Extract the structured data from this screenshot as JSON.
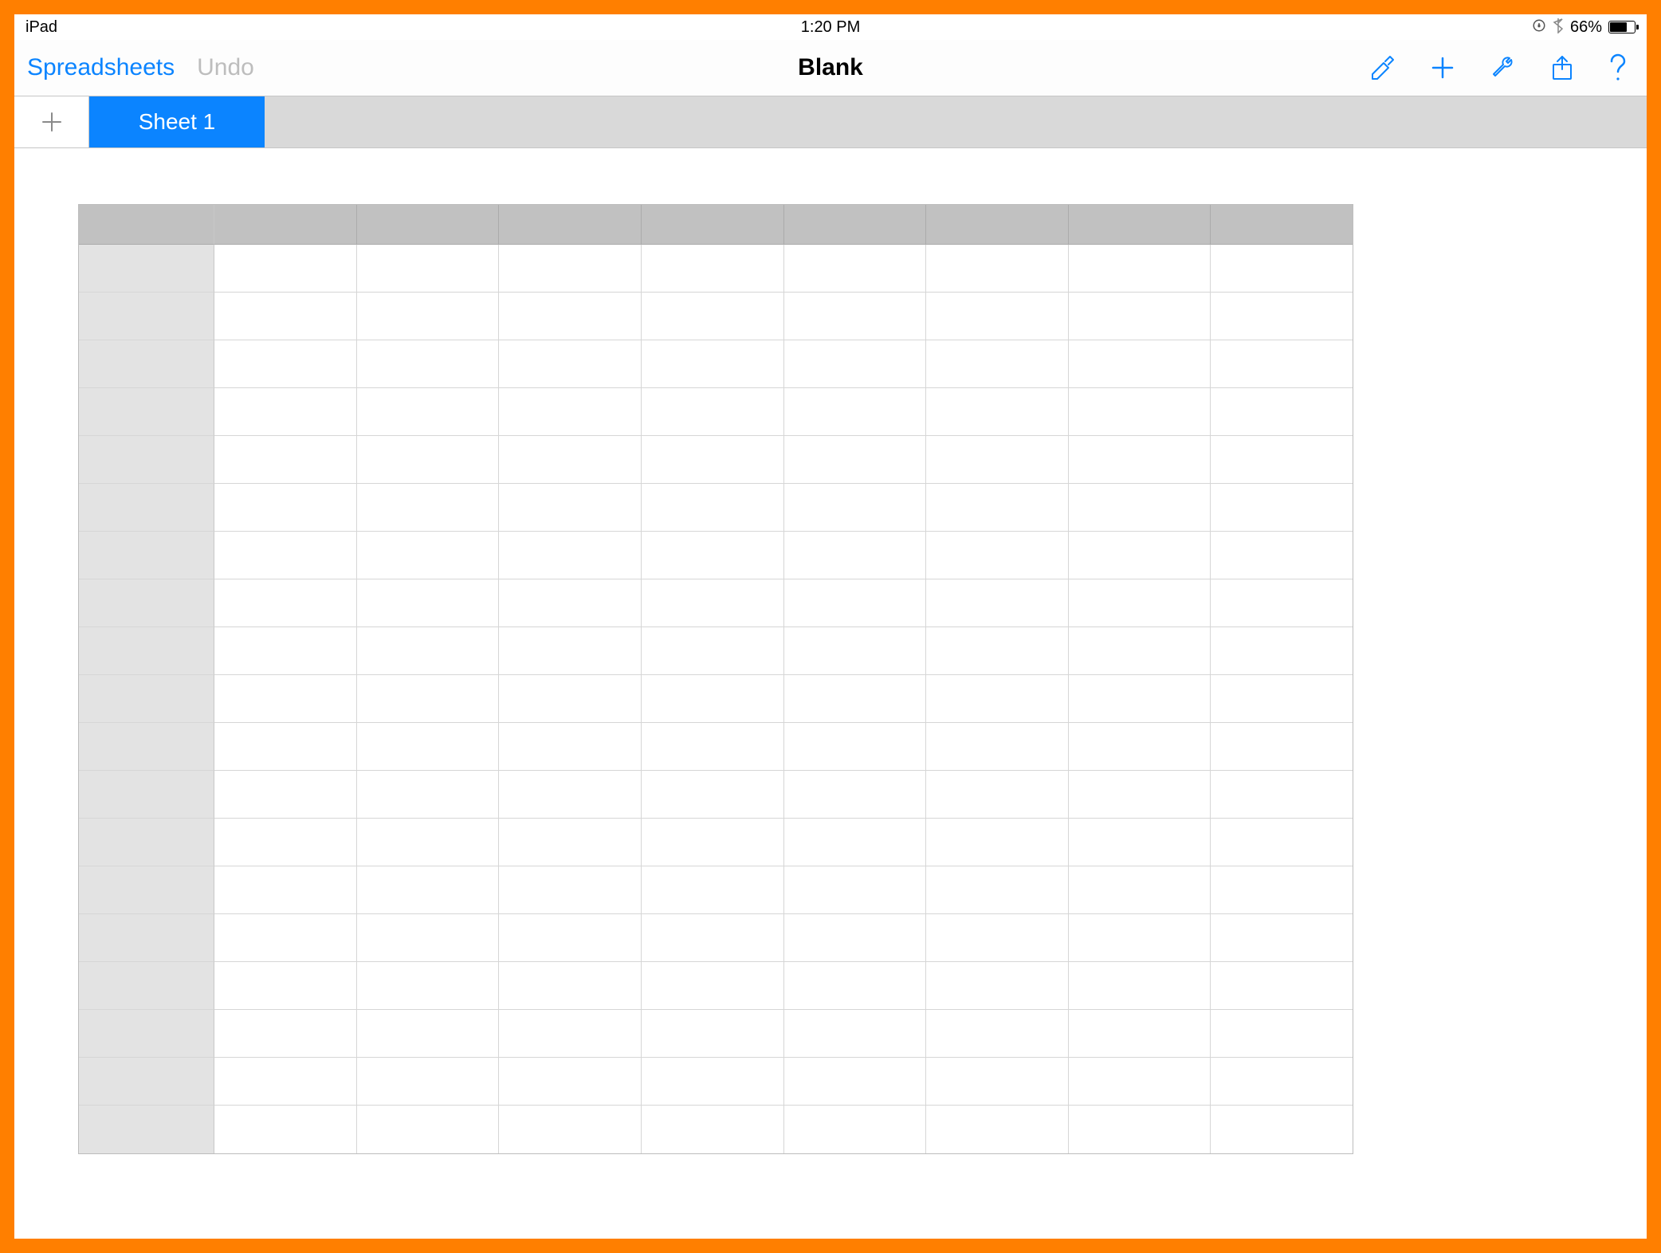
{
  "status_bar": {
    "device": "iPad",
    "time": "1:20 PM",
    "battery_pct": "66%"
  },
  "toolbar": {
    "back_label": "Spreadsheets",
    "undo_label": "Undo",
    "document_title": "Blank"
  },
  "sheet_tabs": {
    "active": "Sheet 1"
  },
  "grid": {
    "columns": 8,
    "rows": 19
  },
  "colors": {
    "accent": "#0b84ff",
    "frame": "#ff7f00"
  }
}
